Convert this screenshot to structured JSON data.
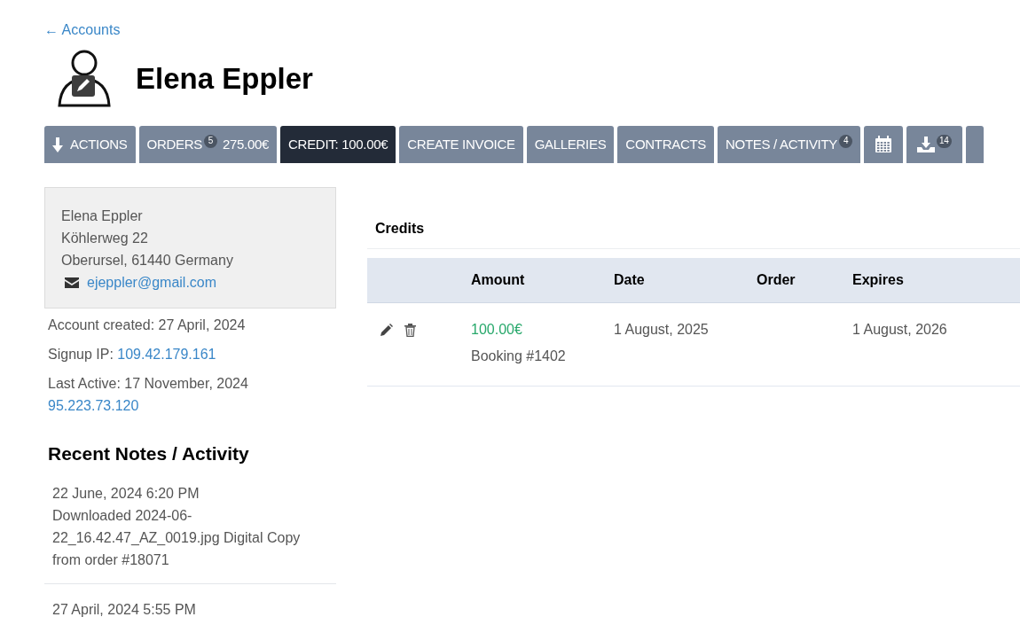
{
  "back_link": "← Accounts",
  "profile": {
    "name": "Elena Eppler"
  },
  "tabs": [
    {
      "kind": "actions",
      "label": "ACTIONS",
      "selected": false
    },
    {
      "kind": "text",
      "label": "ORDERS",
      "badge": "5",
      "suffix": "275.00€",
      "selected": false
    },
    {
      "kind": "text",
      "label": "CREDIT: 100.00€",
      "selected": true
    },
    {
      "kind": "text",
      "label": "CREATE INVOICE",
      "selected": false
    },
    {
      "kind": "text",
      "label": "GALLERIES",
      "selected": false
    },
    {
      "kind": "text",
      "label": "CONTRACTS",
      "selected": false
    },
    {
      "kind": "text",
      "label": "NOTES / ACTIVITY",
      "badge": "4",
      "selected": false
    },
    {
      "kind": "calendar",
      "selected": false
    },
    {
      "kind": "download",
      "badge": "14",
      "selected": false
    }
  ],
  "address": {
    "lines": [
      "Elena Eppler",
      "Köhlerweg 22",
      "Oberursel, 61440 Germany"
    ],
    "email": "ejeppler@gmail.com"
  },
  "account_info": [
    {
      "label": "Account created: 27 April, 2024"
    },
    {
      "label": "Signup IP: ",
      "link": "109.42.179.161"
    },
    {
      "label": "Last Active: 17 November, 2024",
      "link_below": "95.223.73.120"
    }
  ],
  "recent_notes": {
    "title": "Recent Notes / Activity",
    "items": [
      {
        "date": "22 June, 2024 6:20 PM",
        "text": "Downloaded 2024-06-22_16.42.47_AZ_0019.jpg Digital Copy from order #18071"
      },
      {
        "date": "27 April, 2024 5:55 PM"
      }
    ]
  },
  "credits": {
    "title": "Credits",
    "columns": [
      "Amount",
      "Date",
      "Order",
      "Expires"
    ],
    "rows": [
      {
        "amount": "100.00€",
        "note": "Booking #1402",
        "date": "1 August, 2025",
        "expires": "1 August, 2026"
      }
    ]
  }
}
